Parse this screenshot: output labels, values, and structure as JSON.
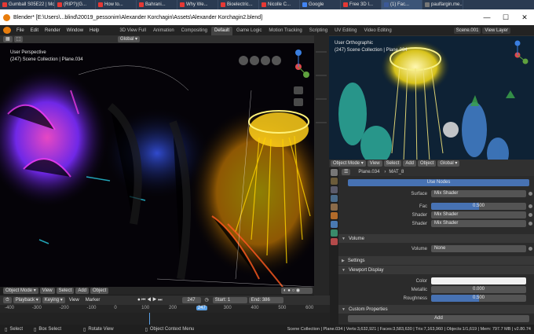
{
  "browser_tabs": [
    {
      "label": "Gumball S05E22 | Mcmc",
      "color": "#e53935",
      "active": false
    },
    {
      "label": "(RIP?)(G...",
      "color": "#e53935",
      "active": false
    },
    {
      "label": "How to...",
      "color": "#e53935",
      "active": false
    },
    {
      "label": "Bahrani...",
      "color": "#e53935",
      "active": false
    },
    {
      "label": "Why We...",
      "color": "#e53935",
      "active": false
    },
    {
      "label": "Bioelectric...",
      "color": "#e53935",
      "active": false
    },
    {
      "label": "Nicolle C...",
      "color": "#e53935",
      "active": false
    },
    {
      "label": "Google",
      "color": "#4285f4",
      "active": false
    },
    {
      "label": "Free 3D I...",
      "color": "#e53935",
      "active": false
    },
    {
      "label": "(1) Fac...",
      "color": "#3b5998",
      "active": true
    },
    {
      "label": "paulfargin.me...",
      "color": "#777777",
      "active": false
    }
  ],
  "window": {
    "title": "Blender* [E:\\Users\\...blind\\20019_pessonim\\Alexander Korchagin\\Assets\\Alexander Korchagin2.blend]",
    "minimize": "—",
    "maximize": "☐",
    "close": "✕"
  },
  "menu": [
    "File",
    "Edit",
    "Render",
    "Window",
    "Help"
  ],
  "workspaces": [
    "3D View Full",
    "Animation",
    "Compositing",
    "Default",
    "Game Logic",
    "Motion Tracking",
    "Scripting",
    "UV Editing",
    "Video Editing"
  ],
  "active_workspace": "Default",
  "scene": {
    "name": "Scene.001",
    "view_layer": "View Layer"
  },
  "left_viewport": {
    "mode_label": "Global",
    "view_name": "User Perspective",
    "collection": "(247) Scene Collection | Plane.034",
    "footer": {
      "mode": "Object Mode",
      "view": "View",
      "select": "Select",
      "add": "Add",
      "object": "Object"
    }
  },
  "right_viewport": {
    "view_name": "User Orthographic",
    "collection": "(247) Scene Collection | Plane.034",
    "footer": {
      "mode": "Object Mode",
      "view": "View",
      "select": "Select",
      "add": "Add",
      "object": "Object",
      "orientation": "Global"
    }
  },
  "properties": {
    "object": "Plane.034",
    "material": "MAT_8",
    "use_nodes": "Use Nodes",
    "surface_label": "Surface",
    "surface_value": "Mix Shader",
    "fac_label": "Fac",
    "fac_value": "0.500",
    "fac_fraction": 0.5,
    "shader1_label": "Shader",
    "shader1_value": "Mix Shader",
    "shader2_label": "Shader",
    "shader2_value": "Mix Shader",
    "volume_section": "Volume",
    "volume_label": "Volume",
    "volume_value": "None",
    "settings_section": "Settings",
    "viewport_display_section": "Viewport Display",
    "color_label": "Color",
    "metallic_label": "Metallic",
    "metallic_value": "0.000",
    "roughness_label": "Roughness",
    "roughness_value": "0.500",
    "roughness_fraction": 0.5,
    "custom_properties_section": "Custom Properties",
    "add_label": "Add"
  },
  "timeline": {
    "playback": "Playback",
    "keying": "Keying",
    "view": "View",
    "marker": "Marker",
    "current_frame": "247",
    "start_label": "Start:",
    "start_value": "1",
    "end_label": "End:",
    "end_value": "386",
    "ruler": [
      "-400",
      "-300",
      "-200",
      "-100",
      "0",
      "100",
      "200",
      "247",
      "300",
      "400",
      "500",
      "600"
    ]
  },
  "statusbar": {
    "select": "Select",
    "box_select": "Box Select",
    "rotate_view": "Rotate View",
    "context_menu": "Object Context Menu",
    "stats": "Scene Collection | Plane.034 | Verts:3,632,921 | Faces:3,583,630 | Tris:7,163,960 | Objects:1/1,619 | Mem: 797.7 MB | v2.80.74"
  }
}
